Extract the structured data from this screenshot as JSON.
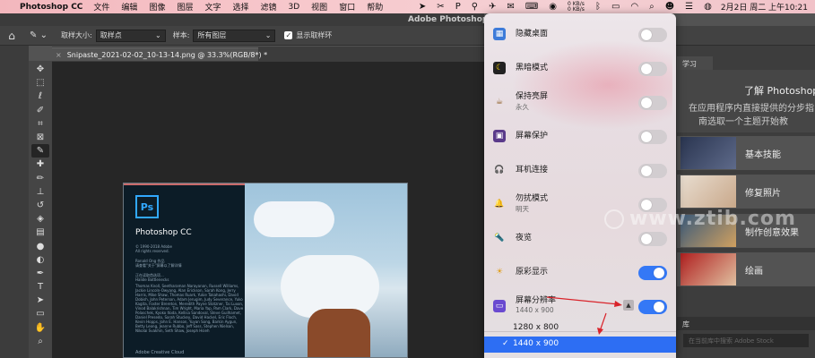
{
  "menubar": {
    "app_name": "Photoshop CC",
    "items": [
      "文件",
      "编辑",
      "图像",
      "图层",
      "文字",
      "选择",
      "滤镜",
      "3D",
      "视图",
      "窗口",
      "帮助"
    ],
    "net_up": "0 KB/s",
    "net_down": "0 KB/s",
    "clock": "2月2日 周二 上午10:21"
  },
  "ps_window": {
    "title": "Adobe Photoshop CC"
  },
  "options_bar": {
    "sample_size_label": "取样大小:",
    "sample_size_value": "取样点",
    "sample_label": "样本:",
    "sample_value": "所有图层",
    "show_ring_label": "显示取样环"
  },
  "document": {
    "tab_title": "Snipaste_2021-02-02_10-13-14.png @ 33.3%(RGB/8*) *"
  },
  "splash": {
    "logo": "Ps",
    "product": "Photoshop CC",
    "copyright_lines": [
      "© 1990-2018 Adobe",
      "All rights reserved."
    ],
    "artist_lines": [
      "Ronald Ong 作品",
      "请查看\"关于\"屏幕以了解详情"
    ],
    "loading_lines": [
      "正在读取首选项...",
      "Halide Bottlenecks"
    ],
    "credits": "Thomas Knoll, Seetharaman Narayanan, Russell Williams, Jackie Lincoln-Owyang, Alan Erickson, Sarah Kong, Jerry Harris, Mike Shaw, Thomas Ruark, Yukie Takahashi, David Dobish, John Peterson, Adam Jerugim, Judy Severance, Yuko Kagita, Foster Brereton, Meredith Payne Stotzner, Tai Luxon, Vinod Balakrishnan, Tim Wright, Maria Yap, Pam Clark, Dave Polaschek, Kyoko Itoda, Kellisa Sandoval, Steve Guilhamet, Daniel Presedo, Sarah Stuckey, David Hackel, Eric Floch, Kevin Hopps, John E. Hanson, Yuyan Song, Barkin Aygun, Betty Leong, Jeanne Rubbo, Jeff Sass, Stephen Nielson, Nikolai Svakhin, Seth Shaw, Joseph Hsieh",
    "cloud_brand": "Adobe Creative Cloud"
  },
  "learn_panel": {
    "tab": "学习",
    "heading": "了解 Photoshop",
    "desc_line1": "在应用程序内直接提供的分步指",
    "desc_line2": "南选取一个主题开始教",
    "cards": [
      "基本技能",
      "修复照片",
      "制作创意效果",
      "绘画"
    ],
    "library_tab": "库",
    "library_search_placeholder": "在当前库中搜索 Adobe Stock"
  },
  "popover": {
    "items": [
      {
        "label": "隐藏桌面",
        "sub": "",
        "on": false
      },
      {
        "label": "黑暗模式",
        "sub": "",
        "on": false
      },
      {
        "label": "保持亮屏",
        "sub": "永久",
        "on": false
      },
      {
        "label": "屏幕保护",
        "sub": "",
        "on": false
      },
      {
        "label": "耳机连接",
        "sub": "",
        "on": false
      },
      {
        "label": "勿扰模式",
        "sub": "明天",
        "on": false
      },
      {
        "label": "夜览",
        "sub": "",
        "on": false
      },
      {
        "label": "原彩显示",
        "sub": "",
        "on": true
      },
      {
        "label": "屏幕分辨率",
        "sub": "1440 x 900",
        "on": true
      }
    ],
    "resolution_options": [
      "1280 x 800",
      "1440 x 900"
    ],
    "selected_resolution": "1440 x 900",
    "check_glyph": "✓",
    "accent_color": "#2d6ef3"
  },
  "watermark": {
    "text": "www.ztib.com"
  }
}
